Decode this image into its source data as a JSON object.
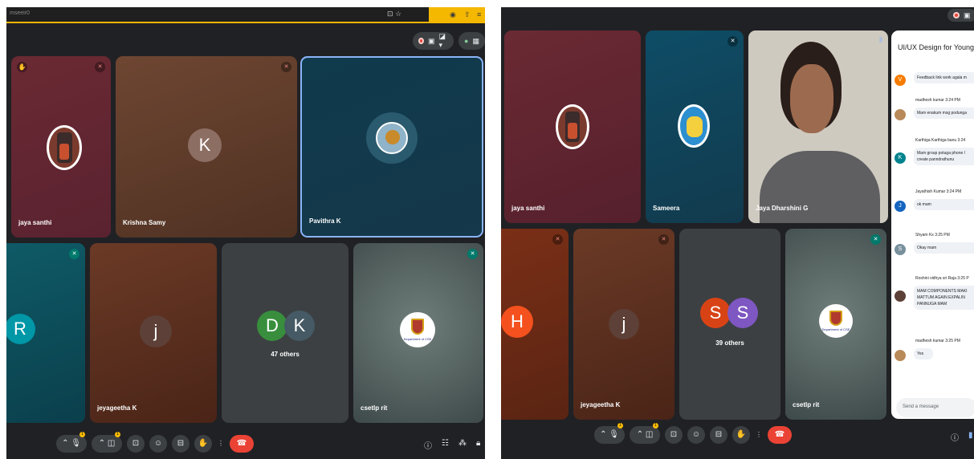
{
  "left": {
    "browser": {
      "address": "mseeir0",
      "icons": [
        "⊡",
        "☆"
      ],
      "right_icons": [
        "◉",
        "⇧",
        "≡"
      ]
    },
    "tiles": [
      {
        "name": "jaya santhi"
      },
      {
        "name": "Krishna Samy",
        "initial": "K"
      },
      {
        "name": "Pavithra K"
      },
      {
        "initial": "R"
      },
      {
        "name": "jeyageetha K",
        "initial": "j"
      },
      {
        "initials": [
          "D",
          "K"
        ],
        "others": "47 others"
      },
      {
        "name": "csetlp rit",
        "logo_caption": "Department of CSE"
      }
    ],
    "bottom_bar": {
      "badge_count": "1"
    },
    "colors": {
      "accent_yellow": "#f5b800",
      "end_call": "#ea4335",
      "pin_border": "#8ab4f8"
    }
  },
  "right": {
    "tiles": [
      {
        "name": "jaya santhi"
      },
      {
        "name": "Sameera"
      },
      {
        "name": "Jaya Dharshini G"
      },
      {
        "initial": "H"
      },
      {
        "name": "jeyageetha K",
        "initial": "j"
      },
      {
        "initials": [
          "S",
          "S"
        ],
        "others": "39 others"
      },
      {
        "name": "csetlp rit",
        "logo_caption": "Department of CSE"
      }
    ],
    "bottom_bar": {
      "badge_count": "1"
    },
    "chat": {
      "title": "UI/UX Design for Young min",
      "messages": [
        {
          "initial": "V",
          "text": "Feedback link work agala m"
        },
        {
          "sender": "madhesh kumar",
          "time": "3:24 PM",
          "text": "Mam enakum msg podunga"
        },
        {
          "sender": "Karthiga Karthiga banu",
          "time": "3:24",
          "initial": "K",
          "text": "Mam group potuga phone l",
          "text2": "create panndrathunu"
        },
        {
          "sender": "Jayathish Kumar",
          "time": "3:24 PM",
          "initial": "J",
          "text": "ok mam"
        },
        {
          "sender": "Shyam Ks",
          "time": "3:25 PM",
          "initial": "S",
          "text": "Okay mam"
        },
        {
          "sender": "Roshini vidhya sri Raja",
          "time": "3:25 P",
          "text": "MAM COMPONENTS MAKI",
          "text2": "MATTUM AGAIN EXPALIN",
          "text3": "PANNUGA MAM"
        },
        {
          "sender": "madhesh kumar",
          "time": "3:25 PM",
          "text": "Yes"
        }
      ],
      "placeholder": "Send a message"
    }
  }
}
